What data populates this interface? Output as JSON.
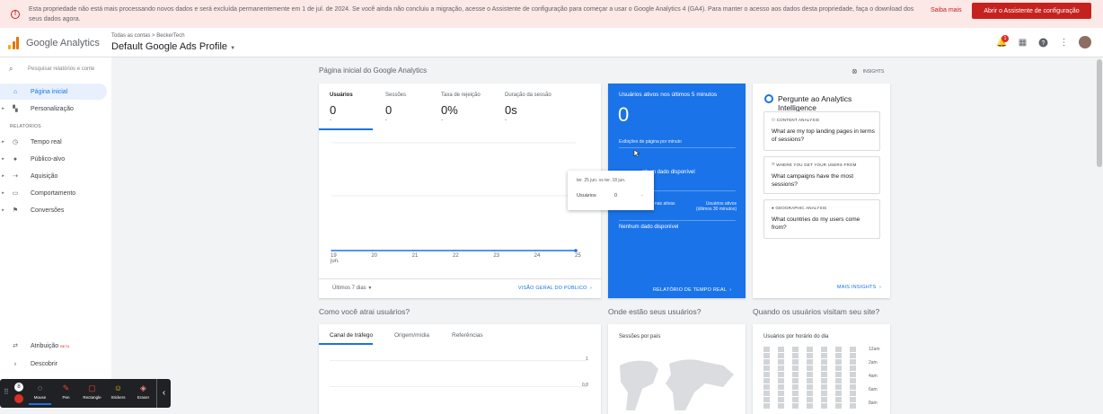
{
  "banner": {
    "message": "Esta propriedade não está mais processando novos dados e será excluída permanentemente em 1 de jul. de 2024. Se você ainda não concluiu a migração, acesse o Assistente de configuração para começar a usar o Google Analytics 4 (GA4). Para manter o acesso aos dados desta propriedade, faça o download dos seus dados agora.",
    "learn_more": "Saiba mais",
    "cta": "Abrir o Assistente de configuração"
  },
  "header": {
    "brand": "Google Analytics",
    "breadcrumb": "Todas as contas > BeckerTech",
    "profile": "Default Google Ads Profile",
    "notification_count": "1"
  },
  "sidebar": {
    "search_placeholder": "Pesquisar relatórios e conte",
    "items_top": [
      {
        "label": "Página inicial",
        "icon": "home-icon"
      },
      {
        "label": "Personalização",
        "icon": "dashboard-icon"
      }
    ],
    "section": "RELATÓRIOS",
    "items_reports": [
      {
        "label": "Tempo real",
        "icon": "clock-icon"
      },
      {
        "label": "Público-alvo",
        "icon": "person-icon"
      },
      {
        "label": "Aquisição",
        "icon": "acquisition-icon"
      },
      {
        "label": "Comportamento",
        "icon": "behavior-icon"
      },
      {
        "label": "Conversões",
        "icon": "flag-icon"
      }
    ],
    "items_bottom": [
      {
        "label": "Atribuição",
        "badge": "BETA",
        "icon": "attribution-icon"
      },
      {
        "label": "Descobrir",
        "icon": "lightbulb-icon"
      }
    ]
  },
  "main": {
    "title": "Página inicial do Google Analytics",
    "insights": "INSIGHTS",
    "overview": {
      "metrics": [
        {
          "label": "Usuários",
          "value": "0",
          "delta": "-"
        },
        {
          "label": "Sessões",
          "value": "0",
          "delta": "-"
        },
        {
          "label": "Taxa de rejeição",
          "value": "0%",
          "delta": "-"
        },
        {
          "label": "Duração da sessão",
          "value": "0s",
          "delta": "-"
        }
      ],
      "x_labels": [
        "19\njun.",
        "20",
        "21",
        "22",
        "23",
        "24",
        "25"
      ],
      "series_values": [
        0,
        0,
        0,
        0,
        0,
        0,
        0
      ],
      "date_range": "Últimos 7 dias",
      "link": "VISÃO GERAL DO PÚBLICO",
      "tooltip": {
        "title": "ter. 25 jun. vs ter. 18 jun.",
        "metric": "Usuários",
        "value": "0",
        "delta": "-"
      }
    },
    "realtime": {
      "title": "Usuários ativos nos últimos 5 minutos",
      "value": "0",
      "pageviews_label": "Exibições de página por minuto",
      "no_data": "nhum dado disponível",
      "pages_label": "nas ativas",
      "active_label": "Usuários ativos (últimos 30 minutos)",
      "no_data_full": "Nenhum dado disponível",
      "link": "RELATÓRIO DE TEMPO REAL"
    },
    "ask": {
      "title": "Pergunte ao Analytics Intelligence",
      "items": [
        {
          "category": "CONTENT ANALYSIS",
          "question": "What are my top landing pages in terms of sessions?",
          "icon": "content-analysis-icon"
        },
        {
          "category": "WHERE YOU GET YOUR USERS FROM",
          "question": "What campaigns have the most sessions?",
          "icon": "users-source-icon"
        },
        {
          "category": "GEOGRAPHIC ANALYSIS",
          "question": "What countries do my users come from?",
          "icon": "location-icon"
        }
      ],
      "link": "MAIS INSIGHTS"
    },
    "sections": {
      "acquisition_title": "Como você atrai usuários?",
      "acquisition_tabs": [
        "Canal de tráfego",
        "Origem/mídia",
        "Referências"
      ],
      "acquisition_y": [
        "1",
        "0,8"
      ],
      "geo_title": "Onde estão seus usuários?",
      "geo_subtitle": "Sessões por país",
      "time_title": "Quando os usuários visitam seu site?",
      "time_subtitle": "Usuários por horário do dia",
      "time_labels": [
        "12am",
        "2am",
        "4am",
        "6am",
        "8am"
      ]
    }
  },
  "toolbar": {
    "tools": [
      {
        "label": "Mouse",
        "icon": "mouse-icon"
      },
      {
        "label": "Pen",
        "icon": "pen-icon"
      },
      {
        "label": "Rectangle",
        "icon": "rectangle-icon"
      },
      {
        "label": "Stickers",
        "icon": "sticker-icon"
      },
      {
        "label": "Eraser",
        "icon": "eraser-icon"
      }
    ],
    "step": "8"
  }
}
